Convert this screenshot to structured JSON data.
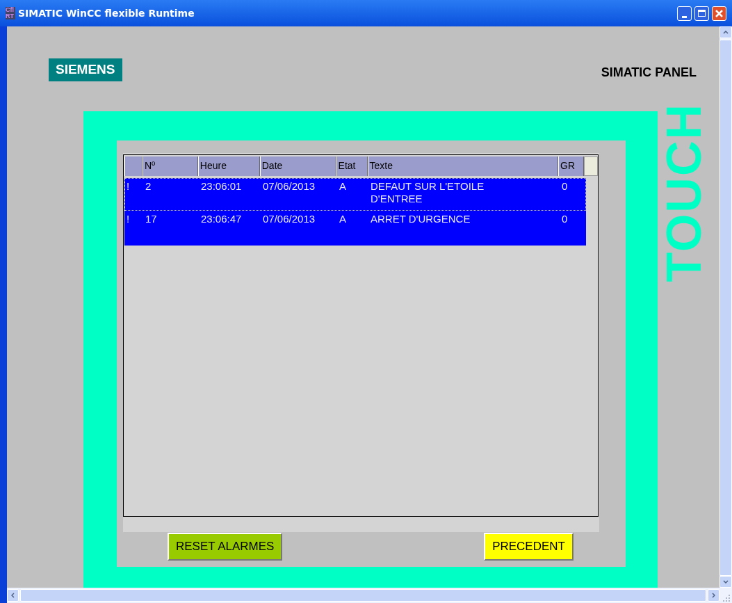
{
  "window": {
    "title": "SIMATIC WinCC flexible Runtime",
    "app_icon": "Cfl RT"
  },
  "header": {
    "logo": "SIEMENS",
    "panel_label": "SIMATIC PANEL",
    "side_label": "TOUCH"
  },
  "alarm_view": {
    "columns": [
      "",
      "Nº",
      "Heure",
      "Date",
      "Etat",
      "Texte",
      "GR"
    ],
    "rows": [
      {
        "cells": [
          "!",
          "2",
          "23:06:01",
          "07/06/2013",
          "A",
          "DEFAUT SUR L'ETOILE D'ENTREE",
          "0"
        ],
        "selected": true,
        "focused": true
      },
      {
        "cells": [
          "!",
          "17",
          "23:06:47",
          "07/06/2013",
          "A",
          "ARRET D'URGENCE",
          "0"
        ],
        "selected": true,
        "focused": false
      }
    ]
  },
  "buttons": [
    {
      "label": "RESET ALARMES",
      "color": "#99cc00"
    },
    {
      "label": "PRECEDENT",
      "color": "#ffff00"
    }
  ]
}
